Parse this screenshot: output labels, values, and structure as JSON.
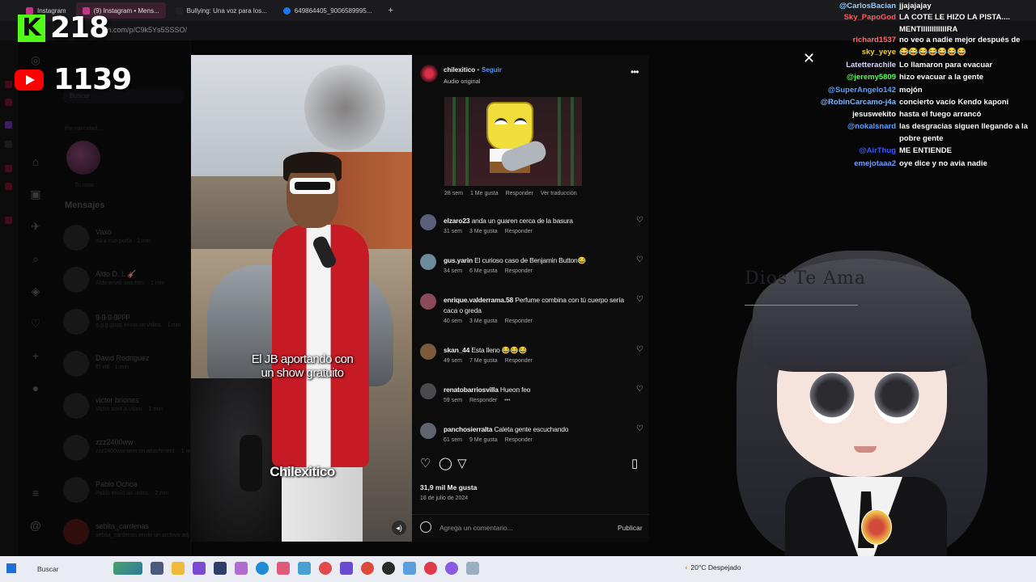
{
  "browser": {
    "tabs": [
      {
        "label": "Instagram",
        "color": "#c13584"
      },
      {
        "label": "(9) Instagram • Mens...",
        "color": "#c13584",
        "active": true
      },
      {
        "label": "Bullying: Una voz para los...",
        "color": "#222222"
      },
      {
        "label": "649864405_9006589995...",
        "color": "#1877f2"
      }
    ],
    "new_tab": "+",
    "url": "m.com/p/C9k5Ys5SSSO/"
  },
  "stream": {
    "kick_logo": "K",
    "kick_count": "218",
    "youtube_count": "1139"
  },
  "instagram_bg": {
    "search_placeholder": "Buscar",
    "note_label": "Tu nota",
    "note_prompt": "Pin cancelad...",
    "messages_title": "Mensajes",
    "conversations": [
      {
        "name": "Vaxo",
        "preview": "mira ese porfa · 1 min"
      },
      {
        "name": "Aldo D. L 🎸",
        "preview": "Aldo envió una foto. · 1 min"
      },
      {
        "name": "g.g.g.gppp",
        "preview": "g.g.g.gppp envió un video. · 1 min"
      },
      {
        "name": "David Rodriguez",
        "preview": "El vt6 · 1 min"
      },
      {
        "name": "victor briones",
        "preview": "Victor sent a video. · 1 min"
      },
      {
        "name": "zzz2400ww",
        "preview": "zzz2400ww sent an attachment. · 1 min"
      },
      {
        "name": "Pablo Ochoa",
        "preview": "Pablo envió un video. · 2 min"
      },
      {
        "name": "sebita_cardenas",
        "preview": "sebita_cardenas envió un archivo adj..."
      }
    ]
  },
  "post": {
    "username": "chilexitico",
    "separator": "•",
    "follow": "Seguir",
    "audio": "Audio original",
    "more": "•••",
    "video_caption": "El JB aportando con un show gratuito",
    "video_brand": "Chilexitico",
    "gif_meta": [
      "28 sem",
      "1 Me gusta",
      "Responder",
      "Ver traducción"
    ],
    "comments": [
      {
        "user": "elzaro23",
        "text": "anda un guaren cerca de la basura",
        "meta": [
          "31 sem",
          "3 Me gusta",
          "Responder"
        ]
      },
      {
        "user": "gus.yarin",
        "text": "El curioso caso de Benjamin Button😂",
        "meta": [
          "34 sem",
          "6 Me gusta",
          "Responder"
        ]
      },
      {
        "user": "enrique.valderrama.58",
        "text": "Perfume combina con tú cuerpo sería caca o greda",
        "meta": [
          "40 sem",
          "3 Me gusta",
          "Responder"
        ]
      },
      {
        "user": "skan_44",
        "text": "Esta lleno 😂😂😂",
        "meta": [
          "49 sem",
          "7 Me gusta",
          "Responder"
        ]
      },
      {
        "user": "renatobarriosvilla",
        "text": "Hueon feo",
        "meta": [
          "59 sem",
          "Responder",
          "•••"
        ]
      },
      {
        "user": "panchosierralta",
        "text": "Caleta gente escuchando",
        "meta": [
          "61 sem",
          "9 Me gusta",
          "Responder"
        ]
      }
    ],
    "likes": "31,9 mil Me gusta",
    "date": "18 de julio de 2024",
    "comment_placeholder": "Agrega un comentario...",
    "publish": "Publicar"
  },
  "close_icon": "✕",
  "chat": [
    {
      "user": "@CarlosBacian",
      "msg": "jjajajajay",
      "color": "#8fd0ff"
    },
    {
      "user": "Sky_PapoGod",
      "msg": "LA COTE LE HIZO LA PISTA.... MENTIIIIIIIIIIIIRA",
      "color": "#ff5a5a"
    },
    {
      "user": "richard1537",
      "msg": "no veo a nadie mejor después de eso",
      "color": "#ff6b6b"
    },
    {
      "user": "sky_yeye",
      "msg": "😂😂😂😂😂😂😂",
      "color": "#f0d040"
    },
    {
      "user": "Latetterachile",
      "msg": "Lo llamaron para evacuar",
      "color": "#d8d8ff"
    },
    {
      "user": "@jeremy5809",
      "msg": "hizo evacuar a la gente",
      "color": "#54ff54"
    },
    {
      "user": "@SuperAngelo142",
      "msg": "mojón",
      "color": "#5aa0ff"
    },
    {
      "user": "@RobinCarcamo-j4a",
      "msg": "concierto vacío Kendo kaponi",
      "color": "#7fb8ff"
    },
    {
      "user": "jesuswekito",
      "msg": "hasta el fuego arrancó",
      "color": "#ffffff"
    },
    {
      "user": "@nokalsnard",
      "msg": "las desgracias siguen llegando a la pobre gente",
      "color": "#5aa0ff"
    },
    {
      "user": "@AirThug",
      "msg": "ME ENTIENDE",
      "color": "#3a5aff"
    },
    {
      "user": "emejotaaa2",
      "msg": "oye dice y no avia nadie",
      "color": "#6f9bff"
    }
  ],
  "vtuber": {
    "sign": "Dios Te Ama"
  },
  "taskbar": {
    "search": "Buscar",
    "weather": "20°C Despejado"
  }
}
